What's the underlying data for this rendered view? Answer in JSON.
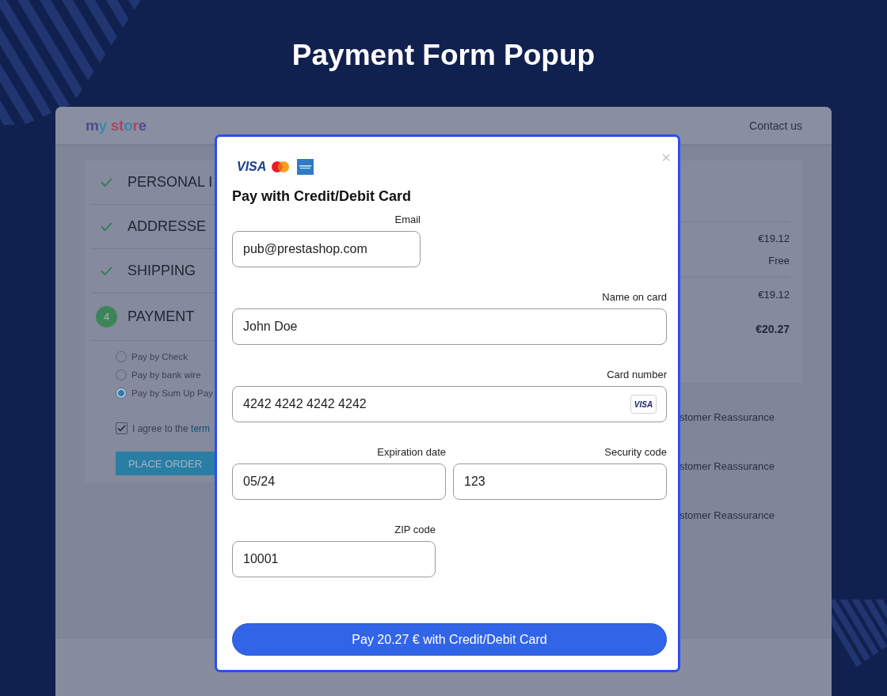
{
  "page": {
    "title": "Payment Form Popup"
  },
  "store": {
    "logo": "my store",
    "contact_link": "Contact us",
    "checkout_steps": [
      {
        "title": "PERSONAL I",
        "completed": true
      },
      {
        "title": "ADDRESSE",
        "completed": true
      },
      {
        "title": "SHIPPING",
        "completed": true
      },
      {
        "title": "PAYMENT",
        "completed": false,
        "number": "4"
      }
    ],
    "payment_options": [
      {
        "label": "Pay by Check",
        "selected": false
      },
      {
        "label": "Pay by bank wire",
        "selected": false
      },
      {
        "label": "Pay by Sum Up Pay",
        "selected": true
      }
    ],
    "terms": {
      "checked": true,
      "text": "I agree to the ",
      "link": "term"
    },
    "place_order_button": "PLACE ORDER",
    "summary": {
      "lines": [
        "€19.12",
        "Free"
      ],
      "totals": [
        {
          "kind": "subtotal",
          "value": "€19.12"
        },
        {
          "kind": "total",
          "value": "€20.27"
        }
      ]
    },
    "reassurance": [
      "stomer Reassurance",
      "stomer Reassurance",
      "stomer Reassurance"
    ]
  },
  "popup": {
    "card_logos": [
      {
        "kind": "visa",
        "text": "VISA"
      },
      {
        "kind": "mastercard"
      },
      {
        "kind": "amex"
      }
    ],
    "close": "×",
    "title": "Pay with Credit/Debit Card",
    "rows": [
      [
        {
          "kind": "email",
          "label": "Email",
          "value": "pub@prestashop.com"
        }
      ],
      [
        {
          "kind": "name",
          "label": "Name on card",
          "value": "John Doe"
        }
      ],
      [
        {
          "kind": "card-number",
          "label": "Card number",
          "value": "4242 4242 4242 4242",
          "badge": "VISA"
        }
      ],
      [
        {
          "kind": "expiry",
          "label": "Expiration date",
          "value": "05/24"
        },
        {
          "kind": "cvc",
          "label": "Security code",
          "value": "123"
        }
      ],
      [
        {
          "kind": "zip",
          "label": "ZIP code",
          "value": "10001"
        }
      ]
    ],
    "pay_button": "Pay 20.27 € with Credit/Debit Card"
  }
}
